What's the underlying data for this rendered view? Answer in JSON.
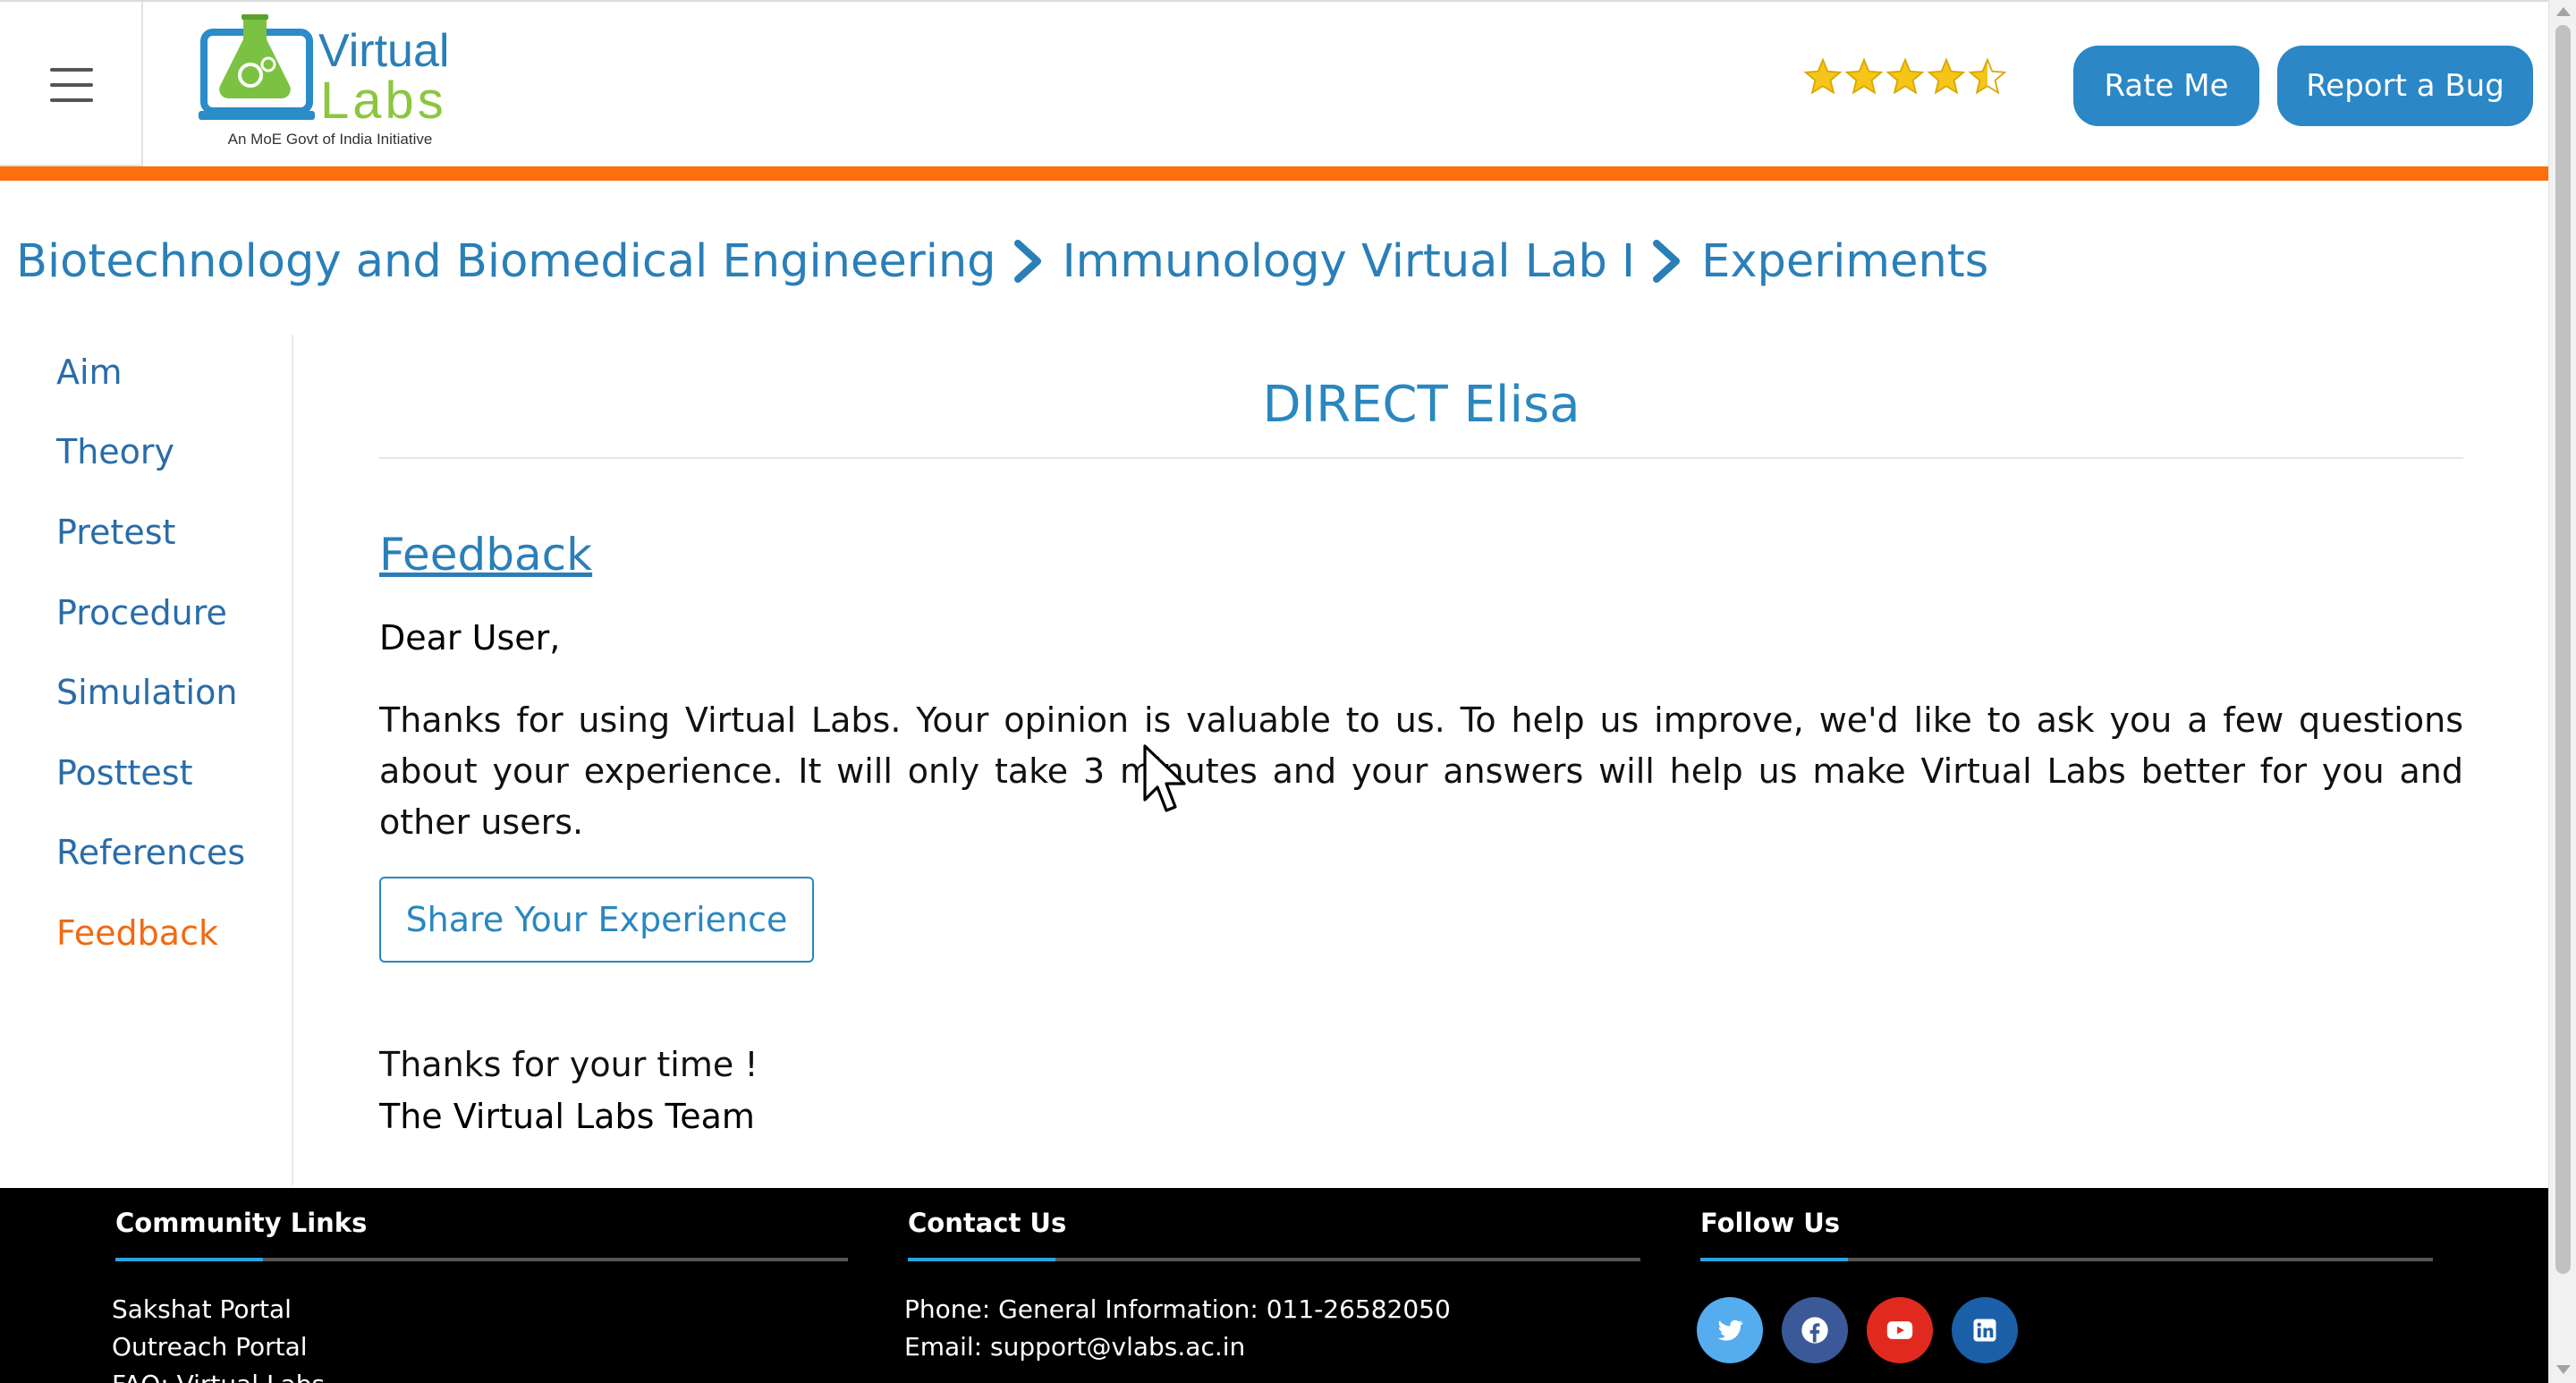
{
  "header": {
    "logo_title_1": "Virtual",
    "logo_title_2": "Labs",
    "logo_tagline": "An MoE Govt of India Initiative",
    "rating_stars": 4.5,
    "rating_max": 5,
    "rate_label": "Rate Me",
    "bug_label": "Report a Bug",
    "accent_color": "#ff6e0e",
    "button_color": "#2b87c5"
  },
  "breadcrumb": {
    "items": [
      "Biotechnology and Biomedical Engineering",
      "Immunology Virtual Lab I",
      "Experiments"
    ]
  },
  "sidebar": {
    "items": [
      {
        "label": "Aim"
      },
      {
        "label": "Theory"
      },
      {
        "label": "Pretest"
      },
      {
        "label": "Procedure"
      },
      {
        "label": "Simulation"
      },
      {
        "label": "Posttest"
      },
      {
        "label": "References"
      },
      {
        "label": "Feedback"
      }
    ],
    "active": "Feedback"
  },
  "main": {
    "title": "DIRECT Elisa",
    "feedback_heading": "Feedback",
    "greeting": "Dear User,",
    "paragraph": "Thanks for using Virtual Labs. Your opinion is valuable to us. To help us improve, we'd like to ask you a few questions about your experience. It will only take 3 minutes and your answers will help us make Virtual Labs better for you and other users.",
    "share_button": "Share Your Experience",
    "thanks": "Thanks for your time !",
    "signature": "The Virtual Labs Team"
  },
  "footer": {
    "community": {
      "heading": "Community Links",
      "links": [
        "Sakshat Portal",
        "Outreach Portal",
        "FAQ: Virtual Labs"
      ]
    },
    "contact": {
      "heading": "Contact Us",
      "phone": "Phone: General Information: 011-26582050",
      "email": "Email: support@vlabs.ac.in"
    },
    "follow": {
      "heading": "Follow Us",
      "icons": [
        "twitter-icon",
        "facebook-icon",
        "youtube-icon",
        "linkedin-icon"
      ]
    }
  }
}
